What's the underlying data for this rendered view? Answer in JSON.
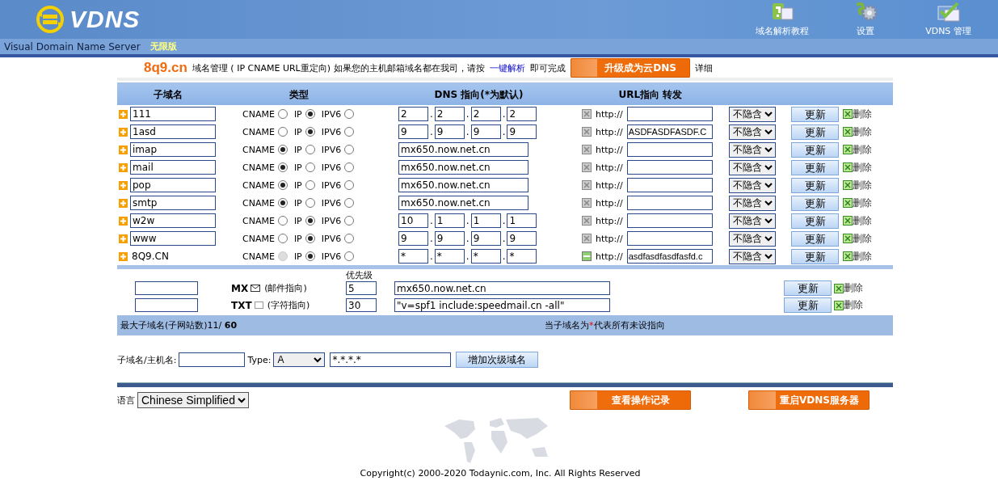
{
  "header": {
    "logo": "VDNS",
    "subtitle": "Visual Domain Name Server",
    "edition": "无限版",
    "nav": [
      {
        "kind": "help",
        "label": "域名解析教程"
      },
      {
        "kind": "settings",
        "label": "设置"
      },
      {
        "kind": "manage",
        "label": "VDNS 管理"
      }
    ]
  },
  "title_row": {
    "domain": "8q9.cn",
    "intro": "域名管理 ( IP CNAME URL重定向)  如果您的主机邮箱域名都在我司，请按",
    "link": "一键解析",
    "suffix": "即可完成",
    "upgrade_button": "升级成为云DNS",
    "details": "详细"
  },
  "table": {
    "columns": [
      "子域名",
      "类型",
      "DNS 指向(*为默认)",
      "URL指向 转发"
    ],
    "rows": [
      {
        "kind": "sub",
        "name": "111",
        "options": [
          {
            "label": "CNAME",
            "selected": false,
            "disabled": false
          },
          {
            "label": "IP",
            "selected": true,
            "disabled": false
          },
          {
            "label": "IPV6",
            "selected": false,
            "disabled": false
          }
        ],
        "octets": [
          {
            "value": "2"
          },
          {
            "dot": ".",
            "value": "2"
          },
          {
            "dot": ".",
            "value": "2"
          },
          {
            "dot": ".",
            "value": "2"
          }
        ],
        "url_enabled": false,
        "url_prefix": "http://",
        "url": "",
        "hide": "不隐含",
        "update": "更新",
        "delete": "删除"
      },
      {
        "kind": "sub",
        "name": "1asd",
        "options": [
          {
            "label": "CNAME",
            "selected": false,
            "disabled": false
          },
          {
            "label": "IP",
            "selected": true,
            "disabled": false
          },
          {
            "label": "IPV6",
            "selected": false,
            "disabled": false
          }
        ],
        "octets": [
          {
            "value": "9"
          },
          {
            "dot": ".",
            "value": "9"
          },
          {
            "dot": ".",
            "value": "9"
          },
          {
            "dot": ".",
            "value": "9"
          }
        ],
        "url_enabled": false,
        "url_prefix": "http://",
        "url": "ASDFASDFASDF.C",
        "hide": "不隐含",
        "update": "更新",
        "delete": "删除"
      },
      {
        "kind": "sub",
        "name": "imap",
        "options": [
          {
            "label": "CNAME",
            "selected": true,
            "disabled": false
          },
          {
            "label": "IP",
            "selected": false,
            "disabled": false
          },
          {
            "label": "IPV6",
            "selected": false,
            "disabled": false
          }
        ],
        "host": "mx650.now.net.cn",
        "url_enabled": false,
        "url_prefix": "http://",
        "url": "",
        "hide": "不隐含",
        "update": "更新",
        "delete": "删除"
      },
      {
        "kind": "sub",
        "name": "mail",
        "options": [
          {
            "label": "CNAME",
            "selected": true,
            "disabled": false
          },
          {
            "label": "IP",
            "selected": false,
            "disabled": false
          },
          {
            "label": "IPV6",
            "selected": false,
            "disabled": false
          }
        ],
        "host": "mx650.now.net.cn",
        "url_enabled": false,
        "url_prefix": "http://",
        "url": "",
        "hide": "不隐含",
        "update": "更新",
        "delete": "删除"
      },
      {
        "kind": "sub",
        "name": "pop",
        "options": [
          {
            "label": "CNAME",
            "selected": true,
            "disabled": false
          },
          {
            "label": "IP",
            "selected": false,
            "disabled": false
          },
          {
            "label": "IPV6",
            "selected": false,
            "disabled": false
          }
        ],
        "host": "mx650.now.net.cn",
        "url_enabled": false,
        "url_prefix": "http://",
        "url": "",
        "hide": "不隐含",
        "update": "更新",
        "delete": "删除"
      },
      {
        "kind": "sub",
        "name": "smtp",
        "options": [
          {
            "label": "CNAME",
            "selected": true,
            "disabled": false
          },
          {
            "label": "IP",
            "selected": false,
            "disabled": false
          },
          {
            "label": "IPV6",
            "selected": false,
            "disabled": false
          }
        ],
        "host": "mx650.now.net.cn",
        "url_enabled": false,
        "url_prefix": "http://",
        "url": "",
        "hide": "不隐含",
        "update": "更新",
        "delete": "删除"
      },
      {
        "kind": "sub",
        "name": "w2w",
        "options": [
          {
            "label": "CNAME",
            "selected": false,
            "disabled": false
          },
          {
            "label": "IP",
            "selected": true,
            "disabled": false
          },
          {
            "label": "IPV6",
            "selected": false,
            "disabled": false
          }
        ],
        "octets": [
          {
            "value": "10"
          },
          {
            "dot": ".",
            "value": "1"
          },
          {
            "dot": ".",
            "value": "1"
          },
          {
            "dot": ".",
            "value": "1"
          }
        ],
        "url_enabled": false,
        "url_prefix": "http://",
        "url": "",
        "hide": "不隐含",
        "update": "更新",
        "delete": "删除"
      },
      {
        "kind": "sub",
        "name": "www",
        "options": [
          {
            "label": "CNAME",
            "selected": false,
            "disabled": false
          },
          {
            "label": "IP",
            "selected": true,
            "disabled": false
          },
          {
            "label": "IPV6",
            "selected": false,
            "disabled": false
          }
        ],
        "octets": [
          {
            "value": "9"
          },
          {
            "dot": ".",
            "value": "9"
          },
          {
            "dot": ".",
            "value": "9"
          },
          {
            "dot": ".",
            "value": "9"
          }
        ],
        "url_enabled": false,
        "url_prefix": "http://",
        "url": "",
        "hide": "不隐含",
        "update": "更新",
        "delete": "删除"
      },
      {
        "kind": "root",
        "name": "8Q9.CN",
        "options": [
          {
            "label": "CNAME",
            "selected": false,
            "disabled": true
          },
          {
            "label": "IP",
            "selected": true,
            "disabled": false
          },
          {
            "label": "IPV6",
            "selected": false,
            "disabled": false
          }
        ],
        "octets": [
          {
            "value": "*"
          },
          {
            "dot": ".",
            "value": "*"
          },
          {
            "dot": ".",
            "value": "*"
          },
          {
            "dot": ".",
            "value": "*"
          }
        ],
        "url_enabled": true,
        "url_prefix": "http://",
        "url": "asdfasdfasdfasfd.c",
        "hide": "不隐含",
        "update": "更新",
        "delete": "删除"
      }
    ]
  },
  "records": {
    "priority_label": "优先级",
    "rows": [
      {
        "kind": "mx",
        "label": "MX",
        "hint": "(邮件指向)",
        "priority": "5",
        "value": "mx650.now.net.cn",
        "update": "更新",
        "delete": "删除"
      },
      {
        "kind": "txt",
        "label": "TXT",
        "hint": "(字符指向)",
        "priority": "30",
        "value": "\"v=spf1 include:speedmail.cn -all\"",
        "update": "更新",
        "delete": "删除"
      }
    ]
  },
  "info_bar": {
    "count": "最大子域名(子网站数)11/ **60**",
    "note": {
      "before": "当子域名为",
      "mark": "*",
      "after": "代表所有未设指向"
    }
  },
  "add_form": {
    "name_label": "子域名/主机名:",
    "type_label": "Type:",
    "type_value": "A",
    "value": "*.*.*.*",
    "button": "增加次级域名"
  },
  "footer": {
    "language_label": "语言",
    "language": "Chinese Simplified",
    "log_button": "查看操作记录",
    "restart_button": "重启VDNS服务器",
    "copyright": "Copyright(c) 2000-2020 Todaynic.com, Inc. All Rights Reserved"
  }
}
